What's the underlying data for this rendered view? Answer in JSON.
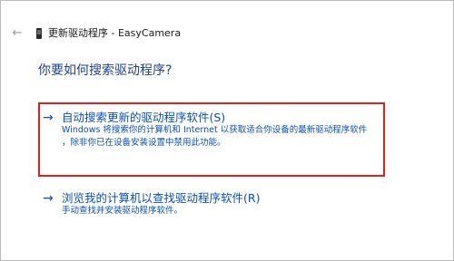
{
  "window": {
    "title": "更新驱动程序 - EasyCamera",
    "back_icon": "back-arrow-icon",
    "device_icon": "camera-device-icon"
  },
  "main": {
    "heading": "你要如何搜索驱动程序?",
    "options": [
      {
        "arrow": "→",
        "title": "自动搜索更新的驱动程序软件(S)",
        "desc_line1": "Windows 将搜索你的计算机和 Internet 以获取适合你设备的最新驱动程序软件",
        "desc_line2": "，除非你已在设备安装设置中禁用此功能。",
        "highlighted": true,
        "highlight_color": "#e0201b"
      },
      {
        "arrow": "→",
        "title": "浏览我的计算机以查找驱动程序软件(R)",
        "desc_line1": "手动查找并安装驱动程序软件。"
      }
    ]
  },
  "colors": {
    "link": "#0a4fb4",
    "heading": "#1f3f8f"
  }
}
